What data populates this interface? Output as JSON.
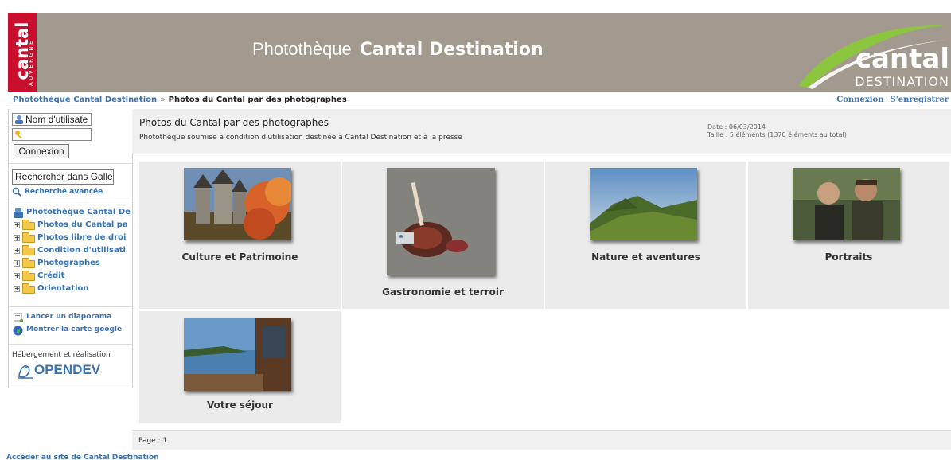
{
  "header": {
    "brand_tile_word": "cantal",
    "brand_tile_sub": "AUVERGNE",
    "title_prefix": "Photothèque",
    "title_strong": "Cantal Destination",
    "logo_word": "cantal",
    "logo_sub": "DESTINATION"
  },
  "breadcrumb": {
    "root": "Photothèque Cantal Destination",
    "separator": "»",
    "current": "Photos du Cantal par des photographes",
    "login_link": "Connexion",
    "register_link": "S'enregistrer"
  },
  "sidebar": {
    "username_value": "Nom d'utilisate",
    "password_value": "",
    "login_button": "Connexion",
    "search_value": "Rechercher dans Galle",
    "advanced_search": "Recherche avancée",
    "tree_root": "Photothèque Cantal De",
    "tree_items": [
      "Photos du Cantal pa",
      "Photos libre de droi",
      "Condition d'utilisati",
      "Photographes",
      "Crédit",
      "Orientation"
    ],
    "slideshow_link": "Lancer un diaporama",
    "map_link": "Montrer la carte google",
    "hosting_label": "Hébergement et réalisation",
    "hosting_logo": "OPENDEV"
  },
  "main": {
    "title": "Photos du Cantal par des photographes",
    "description": "Photothèque soumise à condition d'utilisation destinée à Cantal Destination et à la presse",
    "date": "Date : 06/03/2014",
    "size": "Taille : 5 éléments (1370 éléments au total)",
    "albums": [
      {
        "label": "Culture et Patrimoine"
      },
      {
        "label": "Gastronomie et terroir"
      },
      {
        "label": "Nature et aventures"
      },
      {
        "label": "Portraits"
      },
      {
        "label": "Votre séjour"
      }
    ],
    "page_label": "Page : 1"
  },
  "footer": {
    "site_link": "Accéder au site de Cantal Destination"
  },
  "colors": {
    "banner": "#a29a8e",
    "brand_red": "#c8102e",
    "link_blue": "#3a73b3",
    "logo_green": "#8cc63f"
  }
}
